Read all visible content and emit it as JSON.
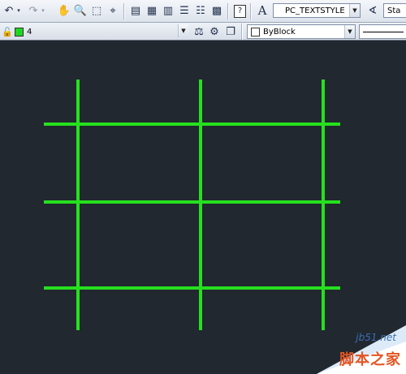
{
  "toolbar": {
    "undo_icon": "undo-icon",
    "redo_icon": "redo-icon",
    "text_style": "PC_TEXTSTYLE",
    "dim_style_partial": "Sta"
  },
  "layer_bar": {
    "layer_name": "4",
    "layer_color": "#1fd61f",
    "lineweight_value": "ByBlock"
  },
  "drawing": {
    "line_color": "#26e01e",
    "background": "#212830",
    "horizontal_lines": 3,
    "vertical_lines": 3
  },
  "watermark": {
    "site": "jb51.net",
    "name": "脚本之家"
  }
}
